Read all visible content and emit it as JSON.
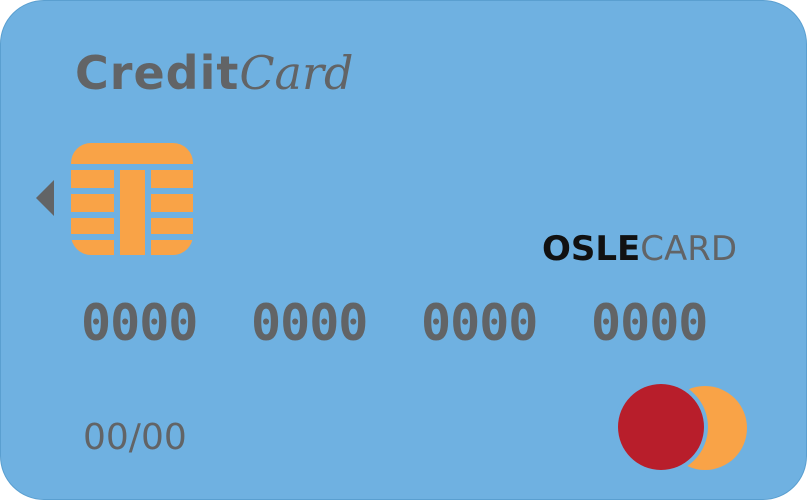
{
  "card": {
    "title_strong": "Credit",
    "title_script": "Card",
    "brand_strong": "OSLE",
    "brand_light": "CARD",
    "number_groups": [
      "0000",
      "0000",
      "0000",
      "0000"
    ],
    "expiry": "00/00"
  },
  "icons": {
    "chip": "chip-icon",
    "arrow": "triangle-left-icon",
    "network": "overlapping-circles-logo"
  },
  "colors": {
    "card_background": "#6fb1e1",
    "text_gray": "#626466",
    "chip_orange": "#f9a347",
    "logo_red": "#b81e2b",
    "logo_orange": "#f9a347"
  }
}
